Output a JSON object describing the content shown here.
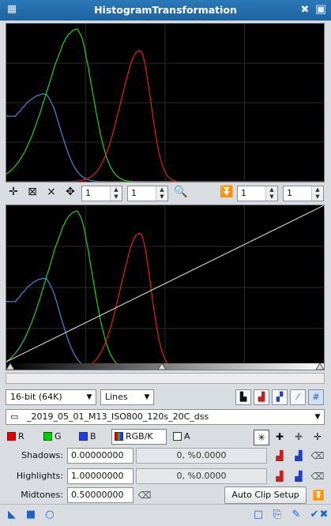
{
  "window": {
    "title": "HistogramTransformation"
  },
  "preview_toolbar": {
    "zoom_x": "1",
    "zoom_y": "1",
    "output_zoom_x": "1",
    "output_zoom_y": "1"
  },
  "controls": {
    "resolution": "16-bit (64K)",
    "graph_style": "Lines",
    "view": "_2019_05_01_M13_ISO800_120s_20C_dss"
  },
  "channels": {
    "r": "R",
    "g": "G",
    "b": "B",
    "rgbk": "RGB/K",
    "a": "A",
    "colors": {
      "r": "#e00000",
      "g": "#00c000",
      "b": "#1a3cff"
    }
  },
  "params": {
    "shadows_label": "Shadows:",
    "shadows_value": "0.00000000",
    "shadows_readout": "0, %0.0000",
    "highlights_label": "Highlights:",
    "highlights_value": "1.00000000",
    "highlights_readout": "0, %0.0000",
    "midtones_label": "Midtones:",
    "midtones_value": "0.50000000",
    "auto_clip_label": "Auto Clip Setup"
  },
  "histogram": {
    "colors": {
      "red": "#e02020",
      "green": "#20d020",
      "blue": "#3c8cdc"
    },
    "peak_positions": {
      "blue": 0.12,
      "green": 0.22,
      "red": 0.42
    }
  }
}
